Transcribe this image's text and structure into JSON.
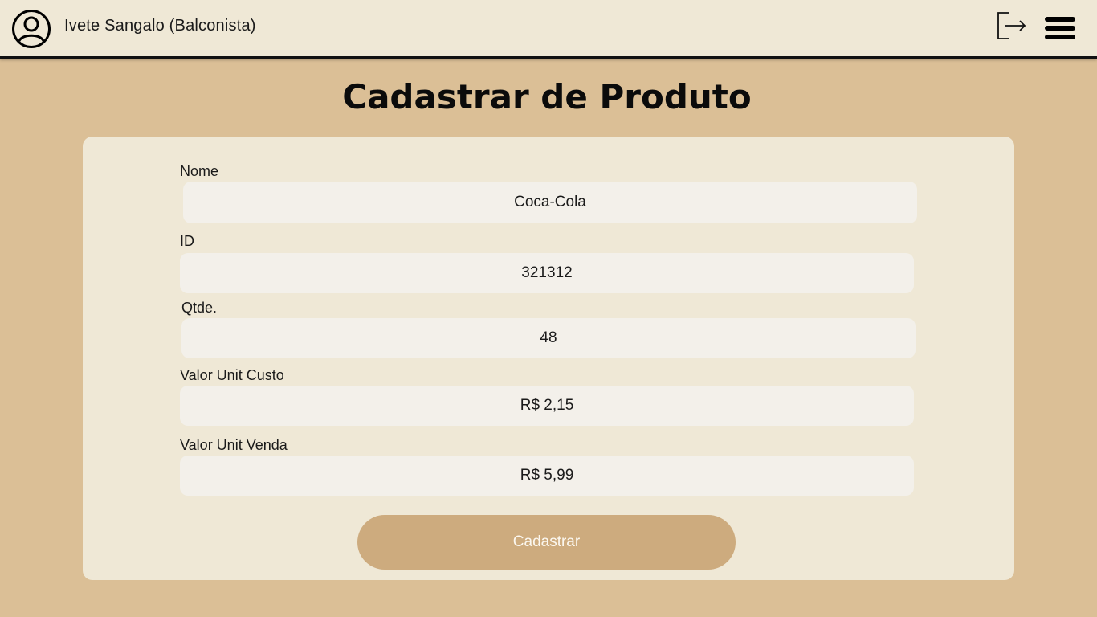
{
  "header": {
    "user_name": "Ivete Sangalo (Balconista)",
    "avatar_icon": "user-circle-icon",
    "logout_icon": "logout-icon",
    "menu_icon": "hamburger-menu-icon"
  },
  "page": {
    "title": "Cadastrar de Produto"
  },
  "form": {
    "fields": [
      {
        "label": "Nome",
        "value": "Coca-Cola"
      },
      {
        "label": "ID",
        "value": "321312"
      },
      {
        "label": "Qtde.",
        "value": "48"
      },
      {
        "label": "Valor Unit Custo",
        "value": "R$ 2,15"
      },
      {
        "label": "Valor Unit Venda",
        "value": "R$ 5,99"
      }
    ],
    "submit_label": "Cadastrar"
  },
  "colors": {
    "background": "#dbbf96",
    "header_bg": "#efe8d6",
    "card_bg": "#efe8d6",
    "input_bg": "#f3f0ea",
    "button_bg": "#cdab7e"
  }
}
